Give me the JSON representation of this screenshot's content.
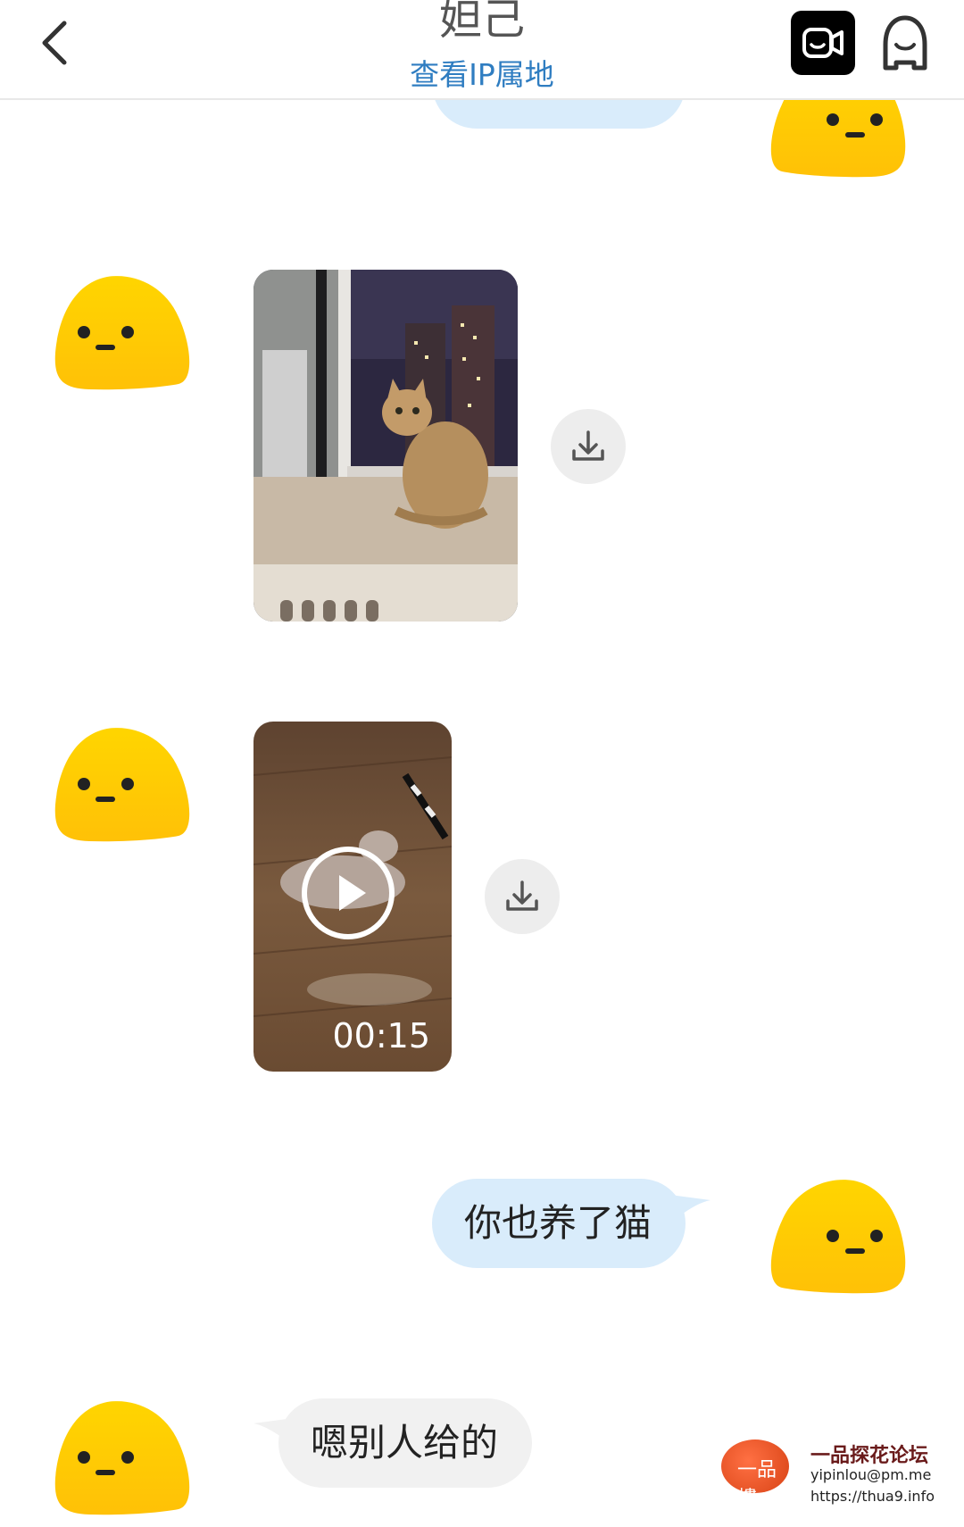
{
  "header": {
    "title": "妲己",
    "subtitle": "查看IP属地",
    "back_icon": "chevron-left-icon",
    "video_call_icon": "video-camera-icon",
    "profile_icon": "person-icon"
  },
  "messages": [
    {
      "direction": "outgoing",
      "type": "text",
      "text": ""
    },
    {
      "direction": "incoming",
      "type": "image",
      "content": "cat sitting by window at night"
    },
    {
      "direction": "incoming",
      "type": "video",
      "duration": "00:15",
      "content": "kitten playing on wooden floor"
    },
    {
      "direction": "outgoing",
      "type": "text",
      "text": "你也养了猫"
    },
    {
      "direction": "incoming",
      "type": "text",
      "text": "嗯别人给的"
    }
  ],
  "watermark": {
    "logo_text": "一品樓",
    "title": "一品探花论坛",
    "line1": "yipinlou@pm.me",
    "line2": "https://thua9.info"
  },
  "colors": {
    "outgoing_bubble": "#d9ecfb",
    "incoming_bubble": "#f1f1f1",
    "avatar_yellow": "#ffd200",
    "link_blue": "#2f7dc1"
  }
}
